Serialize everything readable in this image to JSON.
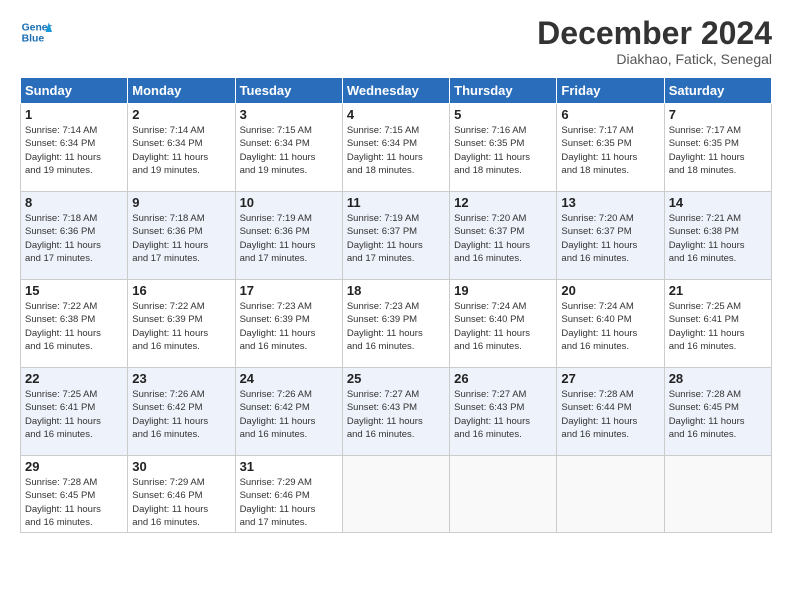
{
  "header": {
    "logo_line1": "General",
    "logo_line2": "Blue",
    "month": "December 2024",
    "location": "Diakhao, Fatick, Senegal"
  },
  "weekdays": [
    "Sunday",
    "Monday",
    "Tuesday",
    "Wednesday",
    "Thursday",
    "Friday",
    "Saturday"
  ],
  "weeks": [
    [
      {
        "day": "1",
        "info": "Sunrise: 7:14 AM\nSunset: 6:34 PM\nDaylight: 11 hours\nand 19 minutes."
      },
      {
        "day": "2",
        "info": "Sunrise: 7:14 AM\nSunset: 6:34 PM\nDaylight: 11 hours\nand 19 minutes."
      },
      {
        "day": "3",
        "info": "Sunrise: 7:15 AM\nSunset: 6:34 PM\nDaylight: 11 hours\nand 19 minutes."
      },
      {
        "day": "4",
        "info": "Sunrise: 7:15 AM\nSunset: 6:34 PM\nDaylight: 11 hours\nand 18 minutes."
      },
      {
        "day": "5",
        "info": "Sunrise: 7:16 AM\nSunset: 6:35 PM\nDaylight: 11 hours\nand 18 minutes."
      },
      {
        "day": "6",
        "info": "Sunrise: 7:17 AM\nSunset: 6:35 PM\nDaylight: 11 hours\nand 18 minutes."
      },
      {
        "day": "7",
        "info": "Sunrise: 7:17 AM\nSunset: 6:35 PM\nDaylight: 11 hours\nand 18 minutes."
      }
    ],
    [
      {
        "day": "8",
        "info": "Sunrise: 7:18 AM\nSunset: 6:36 PM\nDaylight: 11 hours\nand 17 minutes."
      },
      {
        "day": "9",
        "info": "Sunrise: 7:18 AM\nSunset: 6:36 PM\nDaylight: 11 hours\nand 17 minutes."
      },
      {
        "day": "10",
        "info": "Sunrise: 7:19 AM\nSunset: 6:36 PM\nDaylight: 11 hours\nand 17 minutes."
      },
      {
        "day": "11",
        "info": "Sunrise: 7:19 AM\nSunset: 6:37 PM\nDaylight: 11 hours\nand 17 minutes."
      },
      {
        "day": "12",
        "info": "Sunrise: 7:20 AM\nSunset: 6:37 PM\nDaylight: 11 hours\nand 16 minutes."
      },
      {
        "day": "13",
        "info": "Sunrise: 7:20 AM\nSunset: 6:37 PM\nDaylight: 11 hours\nand 16 minutes."
      },
      {
        "day": "14",
        "info": "Sunrise: 7:21 AM\nSunset: 6:38 PM\nDaylight: 11 hours\nand 16 minutes."
      }
    ],
    [
      {
        "day": "15",
        "info": "Sunrise: 7:22 AM\nSunset: 6:38 PM\nDaylight: 11 hours\nand 16 minutes."
      },
      {
        "day": "16",
        "info": "Sunrise: 7:22 AM\nSunset: 6:39 PM\nDaylight: 11 hours\nand 16 minutes."
      },
      {
        "day": "17",
        "info": "Sunrise: 7:23 AM\nSunset: 6:39 PM\nDaylight: 11 hours\nand 16 minutes."
      },
      {
        "day": "18",
        "info": "Sunrise: 7:23 AM\nSunset: 6:39 PM\nDaylight: 11 hours\nand 16 minutes."
      },
      {
        "day": "19",
        "info": "Sunrise: 7:24 AM\nSunset: 6:40 PM\nDaylight: 11 hours\nand 16 minutes."
      },
      {
        "day": "20",
        "info": "Sunrise: 7:24 AM\nSunset: 6:40 PM\nDaylight: 11 hours\nand 16 minutes."
      },
      {
        "day": "21",
        "info": "Sunrise: 7:25 AM\nSunset: 6:41 PM\nDaylight: 11 hours\nand 16 minutes."
      }
    ],
    [
      {
        "day": "22",
        "info": "Sunrise: 7:25 AM\nSunset: 6:41 PM\nDaylight: 11 hours\nand 16 minutes."
      },
      {
        "day": "23",
        "info": "Sunrise: 7:26 AM\nSunset: 6:42 PM\nDaylight: 11 hours\nand 16 minutes."
      },
      {
        "day": "24",
        "info": "Sunrise: 7:26 AM\nSunset: 6:42 PM\nDaylight: 11 hours\nand 16 minutes."
      },
      {
        "day": "25",
        "info": "Sunrise: 7:27 AM\nSunset: 6:43 PM\nDaylight: 11 hours\nand 16 minutes."
      },
      {
        "day": "26",
        "info": "Sunrise: 7:27 AM\nSunset: 6:43 PM\nDaylight: 11 hours\nand 16 minutes."
      },
      {
        "day": "27",
        "info": "Sunrise: 7:28 AM\nSunset: 6:44 PM\nDaylight: 11 hours\nand 16 minutes."
      },
      {
        "day": "28",
        "info": "Sunrise: 7:28 AM\nSunset: 6:45 PM\nDaylight: 11 hours\nand 16 minutes."
      }
    ],
    [
      {
        "day": "29",
        "info": "Sunrise: 7:28 AM\nSunset: 6:45 PM\nDaylight: 11 hours\nand 16 minutes."
      },
      {
        "day": "30",
        "info": "Sunrise: 7:29 AM\nSunset: 6:46 PM\nDaylight: 11 hours\nand 16 minutes."
      },
      {
        "day": "31",
        "info": "Sunrise: 7:29 AM\nSunset: 6:46 PM\nDaylight: 11 hours\nand 17 minutes."
      },
      {
        "day": "",
        "info": ""
      },
      {
        "day": "",
        "info": ""
      },
      {
        "day": "",
        "info": ""
      },
      {
        "day": "",
        "info": ""
      }
    ]
  ]
}
